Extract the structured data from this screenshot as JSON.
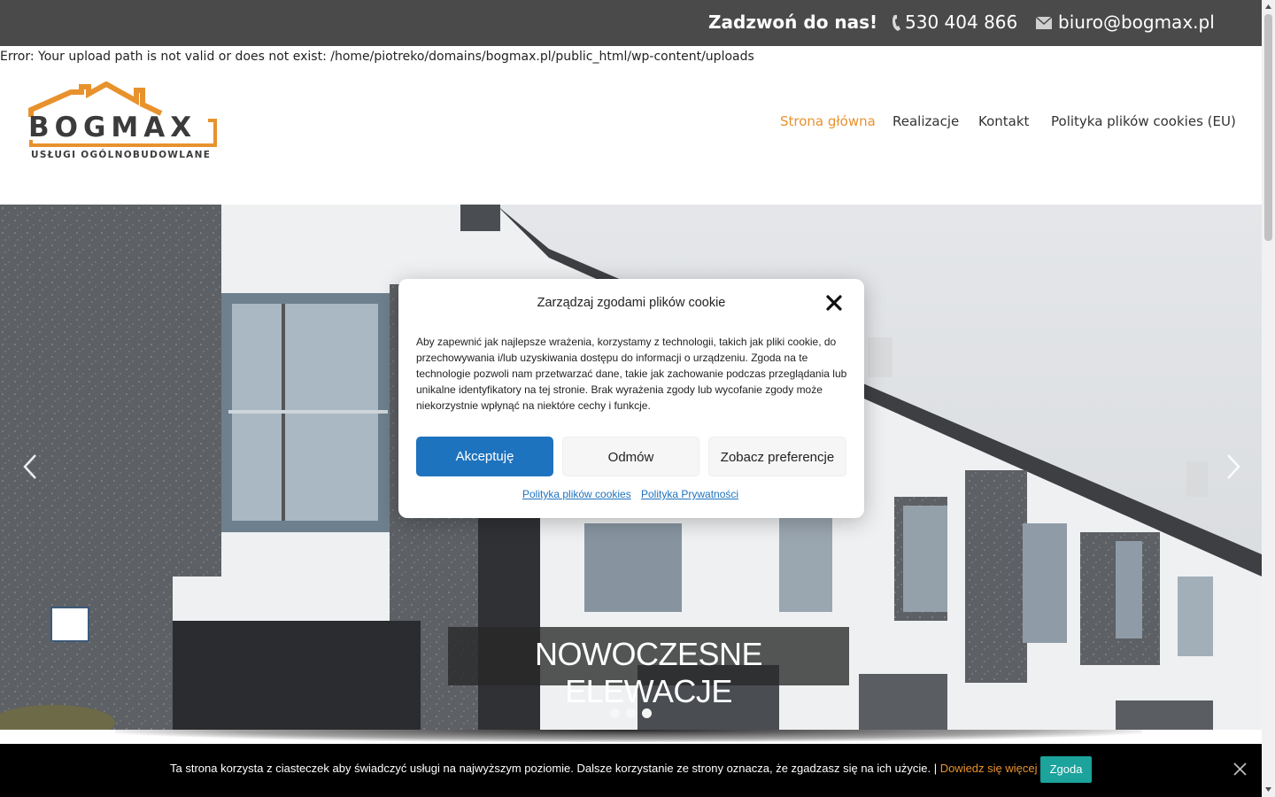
{
  "topbar": {
    "cta": "Zadzwoń do nas!",
    "phone": "530 404 866",
    "email": "biuro@bogmax.pl",
    "icons": [
      "phone-icon",
      "mail-icon"
    ]
  },
  "error_message": "Error: Your upload path is not valid or does not exist: /home/piotreko/domains/bogmax.pl/public_html/wp-content/uploads",
  "logo": {
    "word": "BOGMAX",
    "tagline": "USŁUGI OGÓLNOBUDOWLANE"
  },
  "nav": {
    "items": [
      {
        "label": "Strona główna",
        "active": true
      },
      {
        "label": "Realizacje",
        "active": false
      },
      {
        "label": "Kontakt",
        "active": false
      },
      {
        "label": "Polityka plików cookies (EU)",
        "active": false
      }
    ]
  },
  "hero": {
    "caption": "NOWOCZESNE ELEWACJE",
    "slide_count": 3,
    "active_slide": 3,
    "icons": [
      "chevron-left-icon",
      "chevron-right-icon"
    ]
  },
  "cookie_modal": {
    "title": "Zarządzaj zgodami plików cookie",
    "text": "Aby zapewnić jak najlepsze wrażenia, korzystamy z technologii, takich jak pliki cookie, do przechowywania i/lub uzyskiwania dostępu do informacji o urządzeniu. Zgoda na te technologie pozwoli nam przetwarzać dane, takie jak zachowanie podczas przeglądania lub unikalne identyfikatory na tej stronie. Brak wyrażenia zgody lub wycofanie zgody może niekorzystnie wpłynąć na niektóre cechy i funkcje.",
    "accept_label": "Akceptuję",
    "deny_label": "Odmów",
    "prefs_label": "Zobacz preferencje",
    "cookie_policy_link": "Polityka plików cookies",
    "privacy_link": "Polityka Prywatności"
  },
  "cookie_bar": {
    "text": "Ta strona korzysta z ciasteczek aby świadczyć usługi na najwyższym poziomie. Dalsze korzystanie ze strony oznacza, że zgadzasz się na ich użycie. | ",
    "link": "Dowiedz się więcej",
    "button": "Zgoda"
  },
  "colors": {
    "topbar": "#4a4a4a",
    "brand_orange": "#e8922d",
    "accept_blue": "#1e73be",
    "consent_teal": "#1ba39c"
  }
}
